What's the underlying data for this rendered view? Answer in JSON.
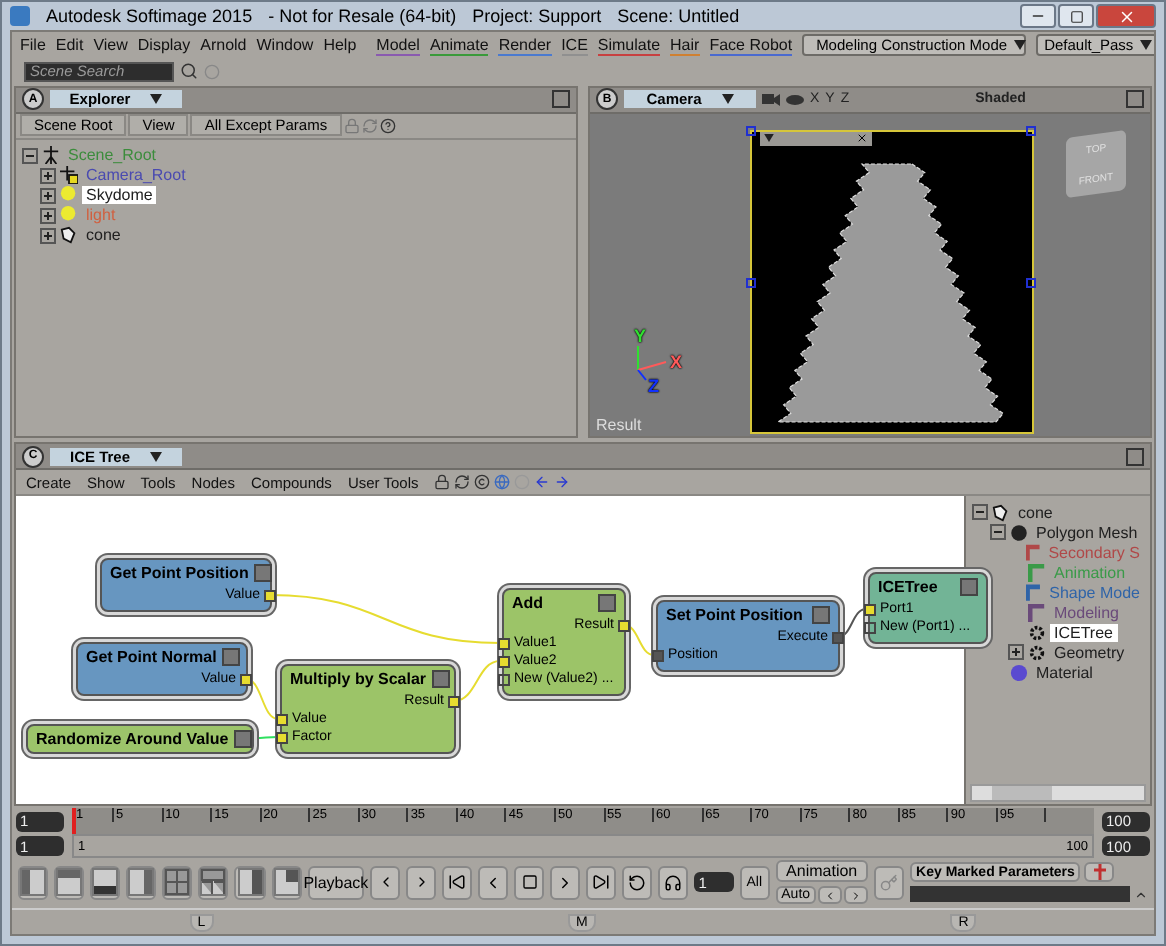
{
  "window": {
    "title_parts": [
      "Autodesk Softimage 2015",
      "- Not for Resale (64-bit)",
      "Project: Support",
      "Scene: Untitled"
    ]
  },
  "menus": [
    "File",
    "Edit",
    "View",
    "Display",
    "Arnold",
    "Window",
    "Help"
  ],
  "modules": [
    {
      "label": "Model",
      "color": "#8a5ab0"
    },
    {
      "label": "Animate",
      "color": "#3a9a3a"
    },
    {
      "label": "Render",
      "color": "#4a7ad0"
    },
    {
      "label": "ICE",
      "color": "#909090"
    },
    {
      "label": "Simulate",
      "color": "#c84040"
    },
    {
      "label": "Hair",
      "color": "#d08030"
    },
    {
      "label": "Face Robot",
      "color": "#4a6ad0"
    }
  ],
  "mode_dropdown": "Modeling Construction Mode",
  "pass_dropdown": "Default_Pass",
  "search": {
    "placeholder": "Scene Search"
  },
  "explorer": {
    "badge": "A",
    "title": "Explorer",
    "toolbar": [
      "Scene Root",
      "View",
      "All Except Params"
    ],
    "tree": [
      {
        "label": "Scene_Root",
        "kind": "root",
        "color": "#3c8c3c",
        "expanded": true,
        "selected": false,
        "children": [
          {
            "label": "Camera_Root",
            "kind": "camera",
            "color": "#4a4ab0",
            "expanded": false,
            "selected": false
          },
          {
            "label": "Skydome",
            "kind": "light",
            "color": "#202020",
            "expanded": false,
            "selected": true
          },
          {
            "label": "light",
            "kind": "light",
            "color": "#d06040",
            "expanded": false,
            "selected": false
          },
          {
            "label": "cone",
            "kind": "mesh",
            "color": "#202020",
            "expanded": false,
            "selected": false
          }
        ]
      }
    ]
  },
  "viewport": {
    "badge": "B",
    "title": "Camera",
    "axes": [
      "X",
      "Y",
      "Z"
    ],
    "mode": "Shaded",
    "cube_faces": [
      "TOP",
      "FRONT"
    ],
    "gizmo_axes": [
      {
        "label": "Y",
        "color": "#30e030"
      },
      {
        "label": "X",
        "color": "#ff5a5a"
      },
      {
        "label": "Z",
        "color": "#1030ff"
      }
    ],
    "caption": "Result"
  },
  "ice": {
    "badge": "C",
    "title": "ICE Tree",
    "menu": [
      "Create",
      "Show",
      "Tools",
      "Nodes",
      "Compounds",
      "User Tools"
    ],
    "nodes": [
      {
        "title": "Get Point Position",
        "kind": "getter",
        "ports": [
          {
            "label": "Value",
            "kind": "output",
            "connected": true
          }
        ]
      },
      {
        "title": "Get Point Normal",
        "kind": "getter",
        "ports": [
          {
            "label": "Value",
            "kind": "output",
            "connected": true
          }
        ]
      },
      {
        "title": "Randomize Around Value",
        "kind": "compact"
      },
      {
        "title": "Multiply by Scalar",
        "kind": "operator",
        "ports": [
          {
            "label": "Result",
            "kind": "output",
            "connected": true
          },
          {
            "label": "Value",
            "kind": "input",
            "connected": true
          },
          {
            "label": "Factor",
            "kind": "input",
            "connected": true
          }
        ]
      },
      {
        "title": "Add",
        "kind": "operator",
        "ports": [
          {
            "label": "Result",
            "kind": "output",
            "connected": true
          },
          {
            "label": "Value1",
            "kind": "input",
            "connected": true
          },
          {
            "label": "Value2",
            "kind": "input",
            "connected": true
          },
          {
            "label": "New (Value2) ...",
            "kind": "input",
            "connected": false
          }
        ]
      },
      {
        "title": "Set Point Position",
        "kind": "setter",
        "ports": [
          {
            "label": "Execute",
            "kind": "output",
            "connected": true
          },
          {
            "label": "Position",
            "kind": "input",
            "connected": true
          }
        ]
      },
      {
        "title": "ICETree",
        "kind": "tree",
        "ports": [
          {
            "label": "Port1",
            "kind": "input",
            "connected": true
          },
          {
            "label": "New (Port1) ...",
            "kind": "input",
            "connected": false
          }
        ]
      }
    ],
    "tree": [
      {
        "label": "cone",
        "kind": "mesh",
        "color": "#202020",
        "expanded": true,
        "selected": false,
        "children": [
          {
            "label": "Polygon Mesh",
            "kind": "polymesh",
            "color": "#202020",
            "expanded": true,
            "selected": false,
            "children": [
              {
                "label": "Secondary S",
                "kind": "stack",
                "color": "#b04848",
                "selected": false
              },
              {
                "label": "Animation",
                "kind": "stack",
                "color": "#3a9a48",
                "selected": false
              },
              {
                "label": "Shape Mode",
                "kind": "stack",
                "color": "#2f64a8",
                "selected": false
              },
              {
                "label": "Modeling",
                "kind": "stack",
                "color": "#6a4a7a",
                "selected": false
              },
              {
                "label": "ICETree",
                "kind": "gear",
                "color": "#202020",
                "selected": true
              },
              {
                "label": "Geometry",
                "kind": "gear",
                "color": "#202020",
                "expanded": false,
                "selected": false
              }
            ]
          },
          {
            "label": "Material",
            "kind": "material",
            "color": "#202020",
            "selected": false
          }
        ]
      }
    ]
  },
  "timeline": {
    "start": "1",
    "end": "100",
    "ticks": [
      "1",
      "5",
      "10",
      "15",
      "20",
      "25",
      "30",
      "35",
      "40",
      "45",
      "50",
      "55",
      "60",
      "65",
      "70",
      "75",
      "80",
      "85",
      "90",
      "95"
    ],
    "level": 0,
    "range": {
      "start": "1",
      "in": "1",
      "out": "100",
      "end": "100",
      "level": 1
    }
  },
  "controls": {
    "playback": "Playback",
    "frame": "1",
    "all": "All",
    "animation": "Animation",
    "auto": "Auto",
    "keys": "Key Marked Parameters"
  },
  "docks": [
    "L",
    "M",
    "R"
  ]
}
